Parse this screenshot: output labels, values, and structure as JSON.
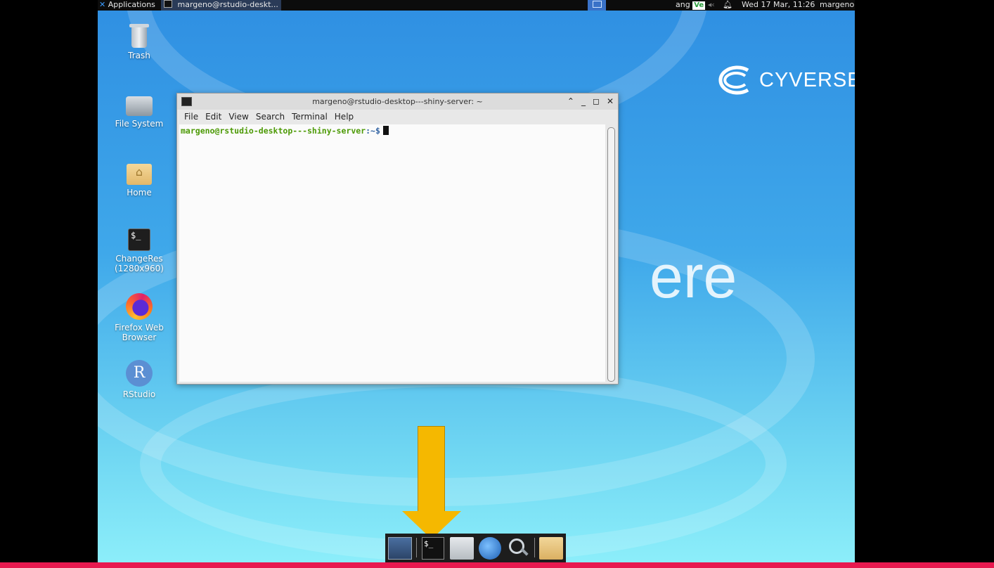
{
  "top_panel": {
    "applications_label": "Applications",
    "task_label": "margeno@rstudio-deskt...",
    "indicator_text": "ang",
    "ve_label": "Ve",
    "clock": "Wed 17 Mar, 11:26",
    "user": "margeno"
  },
  "desktop": {
    "brand": "CYVERSE",
    "watermark": "ere",
    "icons": [
      {
        "label": "Trash"
      },
      {
        "label": "File System"
      },
      {
        "label": "Home"
      },
      {
        "label": "ChangeRes (1280x960)"
      },
      {
        "label": "Firefox Web Browser"
      },
      {
        "label": "RStudio"
      }
    ],
    "term_glyph": "$_",
    "rstudio_letter": "R"
  },
  "terminal": {
    "title": "margeno@rstudio-desktop---shiny-server: ~",
    "menu": [
      "File",
      "Edit",
      "View",
      "Search",
      "Terminal",
      "Help"
    ],
    "prompt_user": "margeno@rstudio-desktop---shiny-server",
    "prompt_path": ":~$"
  },
  "dock": {
    "term_glyph": "$_"
  },
  "colors": {
    "arrow": "#f5b800",
    "bottom_bar": "#e8194f",
    "prompt_user": "#4d9a06",
    "prompt_path": "#3465a4"
  }
}
